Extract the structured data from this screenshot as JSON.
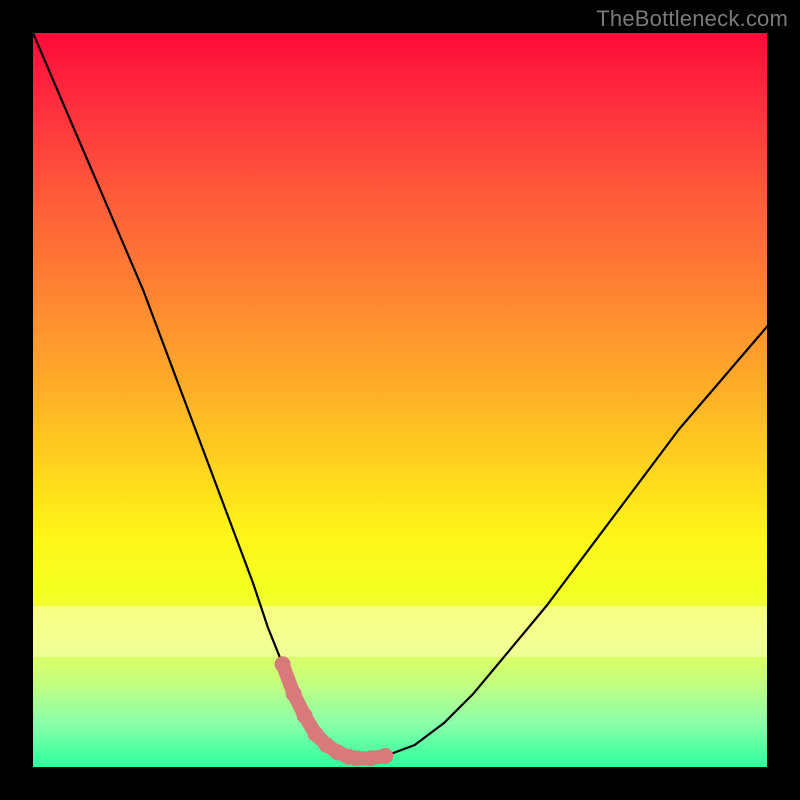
{
  "attribution": "TheBottleneck.com",
  "chart_data": {
    "type": "line",
    "title": "",
    "xlabel": "",
    "ylabel": "",
    "xlim": [
      0,
      100
    ],
    "ylim": [
      0,
      100
    ],
    "series": [
      {
        "name": "curve",
        "color": "#000000",
        "x": [
          0,
          3,
          6,
          9,
          12,
          15,
          18,
          21,
          24,
          27,
          30,
          32,
          34,
          35.5,
          37,
          38.5,
          40,
          41.5,
          43,
          44,
          46,
          48,
          52,
          56,
          60,
          65,
          70,
          76,
          82,
          88,
          94,
          100
        ],
        "y": [
          100,
          93,
          86,
          79,
          72,
          65,
          57,
          49,
          41,
          33,
          25,
          19,
          14,
          10,
          7,
          4.5,
          3,
          2,
          1.4,
          1.2,
          1.2,
          1.5,
          3,
          6,
          10,
          16,
          22,
          30,
          38,
          46,
          53,
          60
        ]
      },
      {
        "name": "highlight-segment",
        "color": "#d87a7a",
        "x": [
          34,
          35.5,
          37,
          38.5,
          40,
          41.5,
          43,
          44,
          46,
          48
        ],
        "y": [
          14,
          10,
          7,
          4.5,
          3,
          2,
          1.4,
          1.2,
          1.2,
          1.5
        ]
      }
    ],
    "bands": [
      {
        "name": "pale-band",
        "y0": 15,
        "y1": 22,
        "color": "#fdffb8",
        "opacity": 0.58
      }
    ],
    "grid": false,
    "legend": false
  }
}
